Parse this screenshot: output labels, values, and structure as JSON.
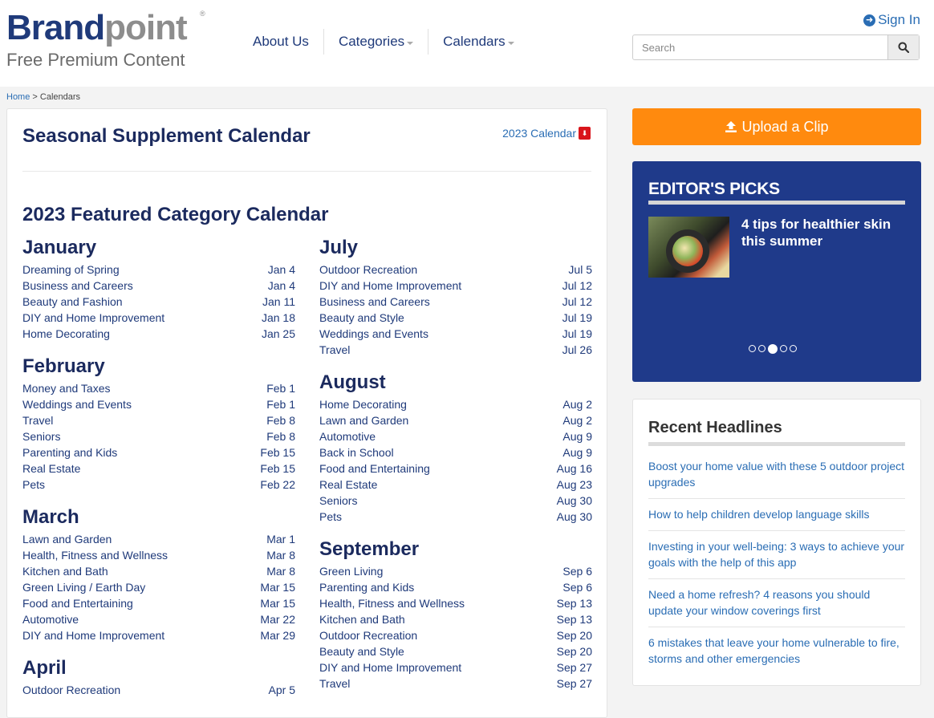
{
  "header": {
    "logo_brand": "Brand",
    "logo_point": "point",
    "logo_reg": "®",
    "tagline": "Free Premium Content",
    "nav": [
      {
        "label": "About Us",
        "dropdown": false
      },
      {
        "label": "Categories",
        "dropdown": true
      },
      {
        "label": "Calendars",
        "dropdown": true
      }
    ],
    "signin_label": "Sign In",
    "search_placeholder": "Search"
  },
  "breadcrumb": {
    "home": "Home",
    "separator": " > ",
    "current": "Calendars"
  },
  "main": {
    "title": "Seasonal Supplement Calendar",
    "calendar_link": "2023 Calendar",
    "featured_title": "2023 Featured Category Calendar",
    "months_left": [
      {
        "name": "January",
        "items": [
          {
            "label": "Dreaming of Spring",
            "date": "Jan 4"
          },
          {
            "label": "Business and Careers",
            "date": "Jan 4"
          },
          {
            "label": "Beauty and Fashion",
            "date": "Jan 11"
          },
          {
            "label": "DIY and Home Improvement",
            "date": "Jan 18"
          },
          {
            "label": "Home Decorating",
            "date": "Jan 25"
          }
        ]
      },
      {
        "name": "February",
        "items": [
          {
            "label": "Money and Taxes",
            "date": "Feb 1"
          },
          {
            "label": "Weddings and Events",
            "date": "Feb 1"
          },
          {
            "label": "Travel",
            "date": "Feb 8"
          },
          {
            "label": "Seniors",
            "date": "Feb 8"
          },
          {
            "label": "Parenting and Kids",
            "date": "Feb 15"
          },
          {
            "label": "Real Estate",
            "date": "Feb 15"
          },
          {
            "label": "Pets",
            "date": "Feb 22"
          }
        ]
      },
      {
        "name": "March",
        "items": [
          {
            "label": "Lawn and Garden",
            "date": "Mar 1"
          },
          {
            "label": "Health, Fitness and Wellness",
            "date": "Mar 8"
          },
          {
            "label": "Kitchen and Bath",
            "date": "Mar 8"
          },
          {
            "label": "Green Living / Earth Day",
            "date": "Mar 15"
          },
          {
            "label": "Food and Entertaining",
            "date": "Mar 15"
          },
          {
            "label": "Automotive",
            "date": "Mar 22"
          },
          {
            "label": "DIY and Home Improvement",
            "date": "Mar 29"
          }
        ]
      },
      {
        "name": "April",
        "items": [
          {
            "label": "Outdoor Recreation",
            "date": "Apr 5"
          }
        ]
      }
    ],
    "months_right": [
      {
        "name": "July",
        "items": [
          {
            "label": "Outdoor Recreation",
            "date": "Jul 5"
          },
          {
            "label": "DIY and Home Improvement",
            "date": "Jul 12"
          },
          {
            "label": "Business and Careers",
            "date": "Jul 12"
          },
          {
            "label": "Beauty and Style",
            "date": "Jul 19"
          },
          {
            "label": "Weddings and Events",
            "date": "Jul 19"
          },
          {
            "label": "Travel",
            "date": "Jul 26"
          }
        ]
      },
      {
        "name": "August",
        "items": [
          {
            "label": "Home Decorating",
            "date": "Aug 2"
          },
          {
            "label": "Lawn and Garden",
            "date": "Aug 2"
          },
          {
            "label": "Automotive",
            "date": "Aug 9"
          },
          {
            "label": "Back in School",
            "date": "Aug 9"
          },
          {
            "label": "Food and Entertaining",
            "date": "Aug 16"
          },
          {
            "label": "Real Estate",
            "date": "Aug 23"
          },
          {
            "label": "Seniors",
            "date": "Aug 30"
          },
          {
            "label": "Pets",
            "date": "Aug 30"
          }
        ]
      },
      {
        "name": "September",
        "items": [
          {
            "label": "Green Living",
            "date": "Sep 6"
          },
          {
            "label": "Parenting and Kids",
            "date": "Sep 6"
          },
          {
            "label": "Health, Fitness and Wellness",
            "date": "Sep 13"
          },
          {
            "label": "Kitchen and Bath",
            "date": "Sep 13"
          },
          {
            "label": "Outdoor Recreation",
            "date": "Sep 20"
          },
          {
            "label": "Beauty and Style",
            "date": "Sep 20"
          },
          {
            "label": "DIY and Home Improvement",
            "date": "Sep 27"
          },
          {
            "label": "Travel",
            "date": "Sep 27"
          }
        ]
      }
    ]
  },
  "sidebar": {
    "upload_label": "Upload a Clip",
    "editors_picks_title": "EDITOR'S PICKS",
    "pick_headline": "4 tips for healthier skin this summer",
    "carousel": {
      "count": 5,
      "active_index": 2
    },
    "recent_title": "Recent Headlines",
    "recent_headlines": [
      "Boost your home value with these 5 outdoor project upgrades",
      "How to help children develop language skills",
      "Investing in your well-being: 3 ways to achieve your goals with the help of this app",
      "Need a home refresh? 4 reasons you should update your window coverings first",
      "6 mistakes that leave your home vulnerable to fire, storms and other emergencies"
    ]
  },
  "colors": {
    "brand_navy": "#1f3a7a",
    "link_blue": "#2a6db4",
    "upload_orange": "#ff8a0e",
    "picks_blue": "#1f3a8a",
    "pdf_red": "#d9151b"
  },
  "icons": {
    "signin": "arrow-circle-right-icon",
    "search": "magnifier-icon",
    "upload": "upload-icon",
    "pdf": "pdf-icon"
  }
}
